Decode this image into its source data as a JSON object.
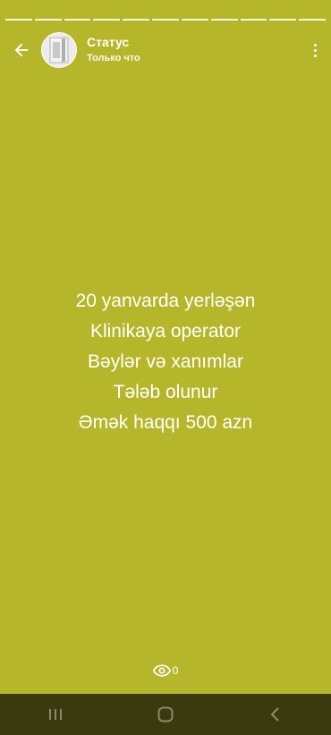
{
  "header": {
    "title": "Статус",
    "time": "Только что"
  },
  "status": {
    "lines": [
      "20 yanvarda yerləşən",
      "Klinikaya operator",
      "Bəylər və xanımlar",
      "Tələb olunur",
      "Əmək haqqı 500 azn"
    ],
    "background_color": "#b5b62a"
  },
  "views": {
    "count": "0",
    "icon": "eye-icon"
  },
  "progress": {
    "segments": 11,
    "viewed": 11
  },
  "navbar": {
    "recent_icon": "recent-apps-icon",
    "home_icon": "home-icon",
    "back_icon": "back-icon"
  }
}
